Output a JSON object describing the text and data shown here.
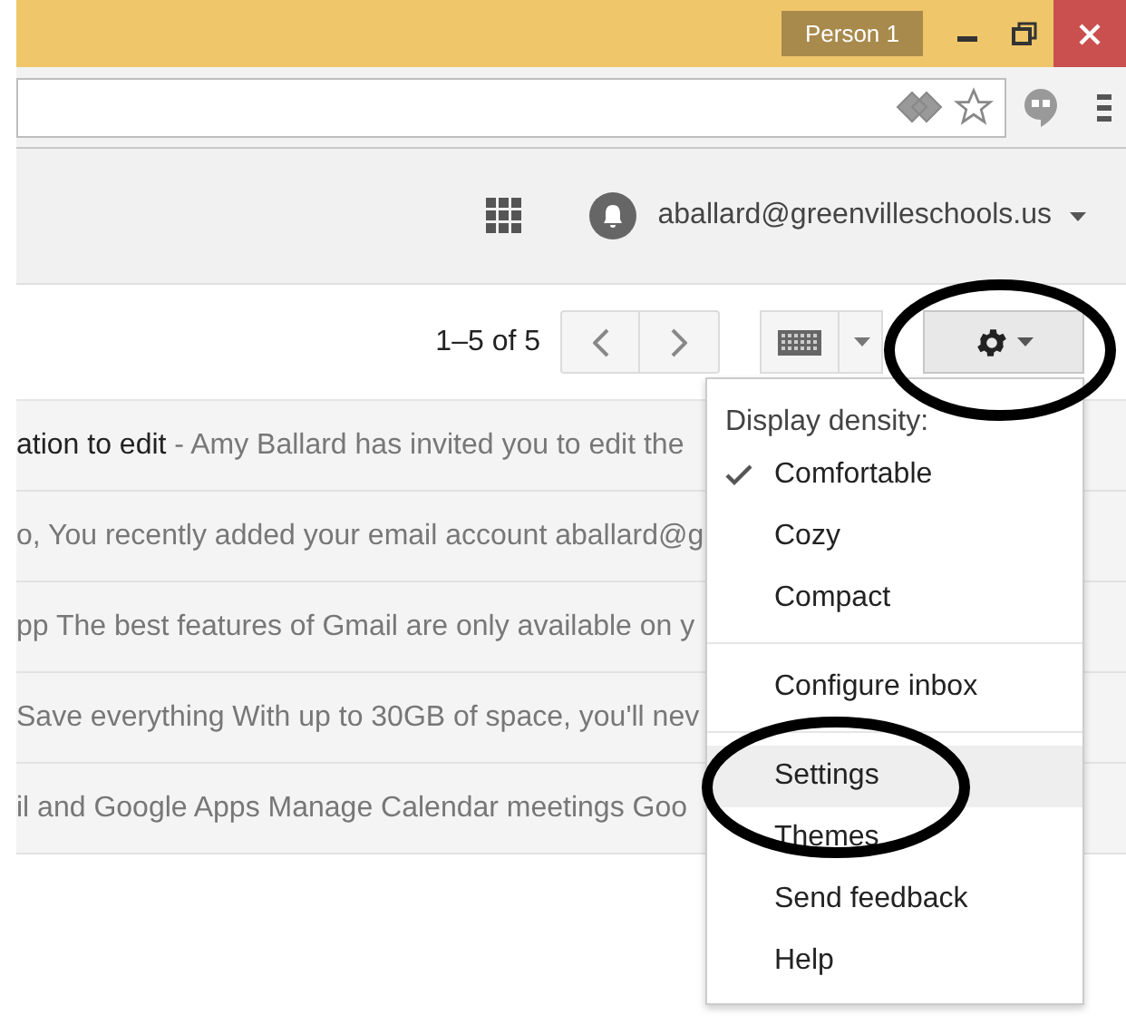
{
  "window": {
    "profile": "Person 1"
  },
  "account": {
    "email": "aballard@greenvilleschools.us"
  },
  "pager": {
    "range": "1–5 of 5"
  },
  "messages": [
    {
      "subject": "ation to edit",
      "snippet": " - Amy Ballard has invited you to edit the"
    },
    {
      "snippet": "o, You recently added your email account aballard@g"
    },
    {
      "snippet": "pp The best features of Gmail are only available on y"
    },
    {
      "snippet": "Save everything With up to 30GB of space, you'll nev"
    },
    {
      "snippet": "il and Google Apps Manage Calendar meetings Goo"
    }
  ],
  "menu": {
    "heading": "Display density:",
    "items": [
      {
        "kind": "option",
        "label": "Comfortable",
        "checked": true,
        "selected": false
      },
      {
        "kind": "option",
        "label": "Cozy",
        "checked": false,
        "selected": false
      },
      {
        "kind": "option",
        "label": "Compact",
        "checked": false,
        "selected": false
      },
      {
        "kind": "divider"
      },
      {
        "kind": "action",
        "label": "Configure inbox",
        "selected": false
      },
      {
        "kind": "divider"
      },
      {
        "kind": "action",
        "label": "Settings",
        "selected": true
      },
      {
        "kind": "action",
        "label": "Themes",
        "selected": false
      },
      {
        "kind": "action",
        "label": "Send feedback",
        "selected": false
      },
      {
        "kind": "action",
        "label": "Help",
        "selected": false
      }
    ]
  }
}
